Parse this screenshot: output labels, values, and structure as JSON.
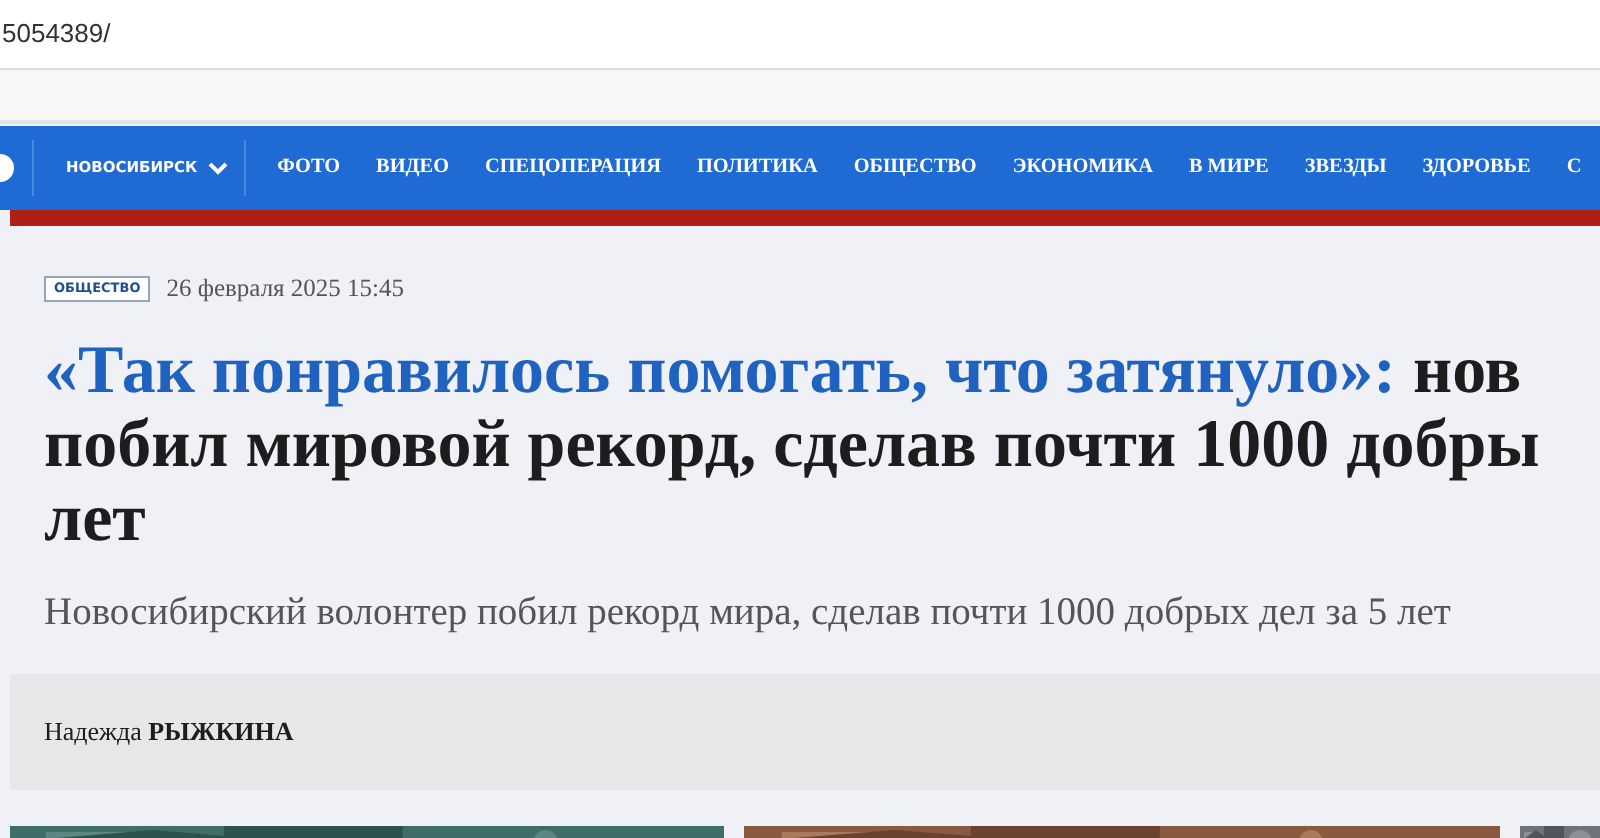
{
  "address_bar": {
    "url": "5054389/"
  },
  "nav": {
    "region": "НОВОСИБИРСК",
    "items": [
      "ФОТО",
      "ВИДЕО",
      "СПЕЦОПЕРАЦИЯ",
      "ПОЛИТИКА",
      "ОБЩЕСТВО",
      "ЭКОНОМИКА",
      "В МИРЕ",
      "ЗВЕЗДЫ",
      "ЗДОРОВЬЕ",
      "С"
    ]
  },
  "article": {
    "tag": "ОБЩЕСТВО",
    "date": "26 февраля 2025 15:45",
    "headline": {
      "accent": "«Так понравилось помогать, что затянуло»:",
      "lines": [
        "нов",
        "побил мировой рекорд, сделав почти 1000 добры",
        "лет"
      ]
    },
    "subtitle": "Новосибирский волонтер побил рекорд мира, сделав почти 1000 добрых дел за 5 лет",
    "author": "Надежда **РЫЖКИНА**"
  }
}
